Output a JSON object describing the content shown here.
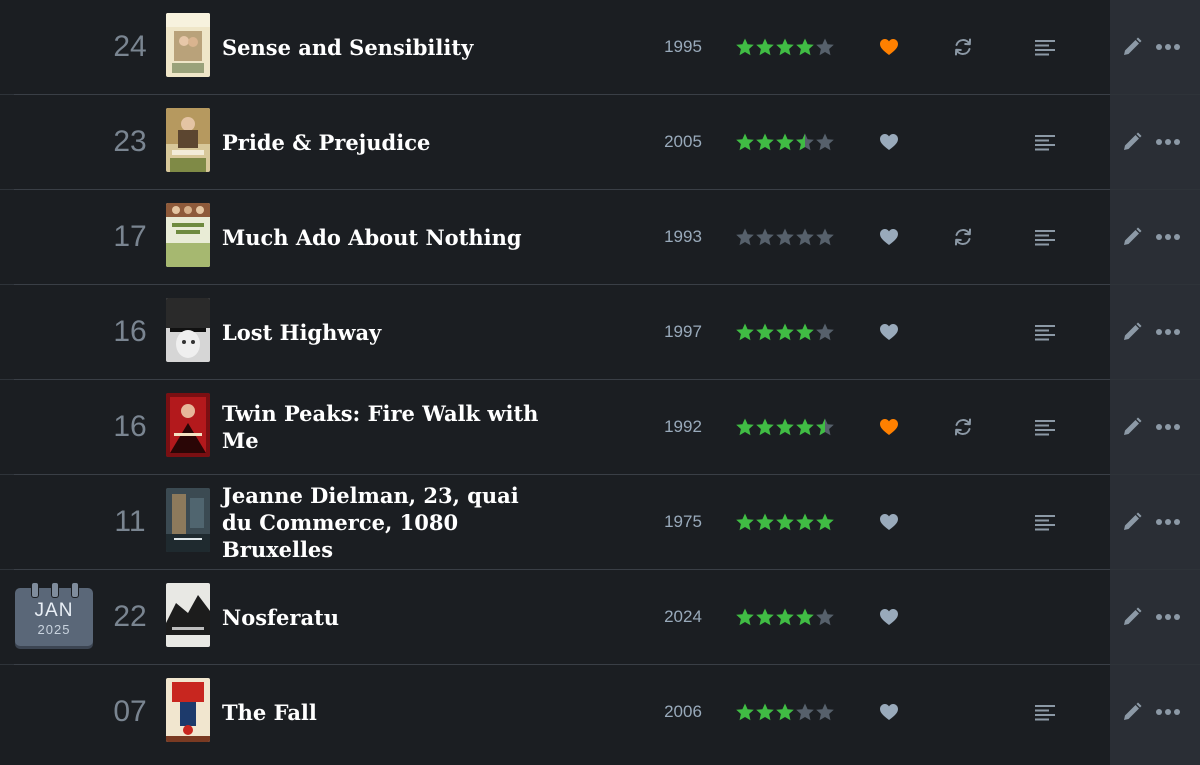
{
  "calendar": {
    "month": "JAN",
    "year": "2025"
  },
  "colors": {
    "star_full": "#40bc44",
    "star_empty": "#56606b",
    "like_on": "#ff8000",
    "like_off": "#99aabb",
    "icon": "#8c99a6"
  },
  "entries": [
    {
      "day": "24",
      "title": "Sense and Sensibility",
      "year": "1995",
      "rating": 4,
      "liked": true,
      "rewatch": true,
      "review": true,
      "poster": "poster-sense-and-sensibility"
    },
    {
      "day": "23",
      "title": "Pride & Prejudice",
      "year": "2005",
      "rating": 3.5,
      "liked": false,
      "rewatch": false,
      "review": true,
      "poster": "poster-pride-and-prejudice"
    },
    {
      "day": "17",
      "title": "Much Ado About Nothing",
      "year": "1993",
      "rating": 0,
      "liked": false,
      "rewatch": true,
      "review": true,
      "poster": "poster-much-ado"
    },
    {
      "day": "16",
      "title": "Lost Highway",
      "year": "1997",
      "rating": 4,
      "liked": false,
      "rewatch": false,
      "review": true,
      "poster": "poster-lost-highway"
    },
    {
      "day": "16",
      "title": "Twin Peaks: Fire Walk with Me",
      "year": "1992",
      "rating": 4.5,
      "liked": true,
      "rewatch": true,
      "review": true,
      "poster": "poster-twin-peaks"
    },
    {
      "day": "11",
      "title": "Jeanne Dielman, 23, quai du Commerce, 1080 Bruxelles",
      "year": "1975",
      "rating": 5,
      "liked": false,
      "rewatch": false,
      "review": true,
      "poster": "poster-jeanne-dielman"
    },
    {
      "day": "22",
      "title": "Nosferatu",
      "year": "2024",
      "rating": 4,
      "liked": false,
      "rewatch": false,
      "review": false,
      "poster": "poster-nosferatu"
    },
    {
      "day": "07",
      "title": "The Fall",
      "year": "2006",
      "rating": 3,
      "liked": false,
      "rewatch": false,
      "review": true,
      "poster": "poster-the-fall"
    }
  ]
}
